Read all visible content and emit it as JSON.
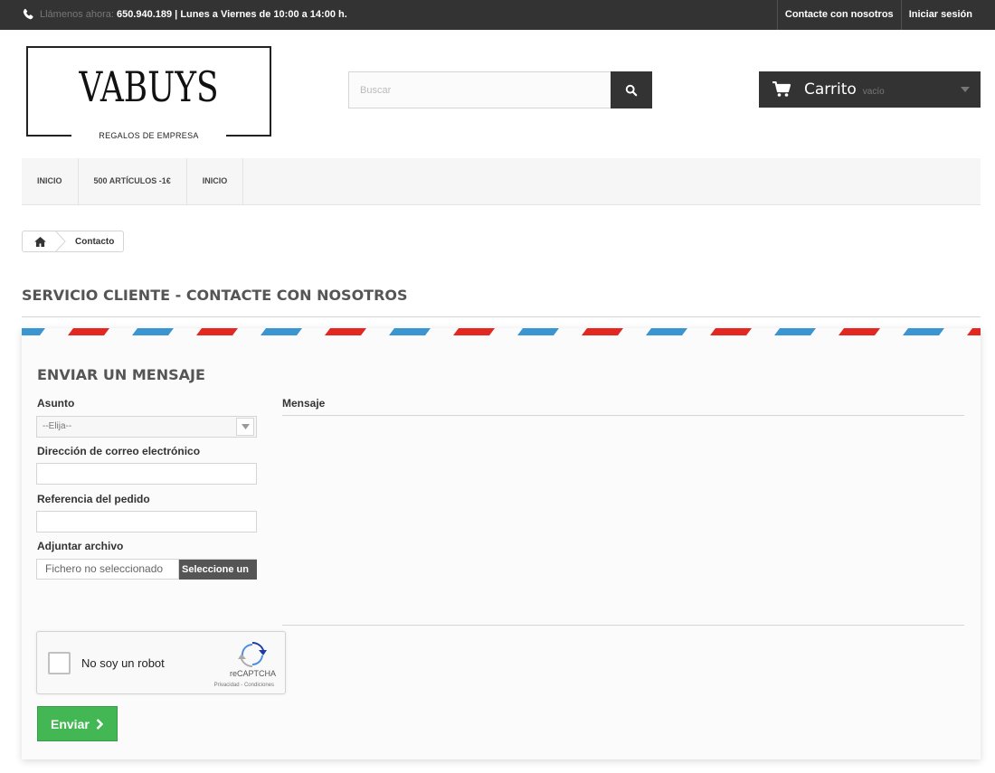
{
  "topbar": {
    "phone_prefix": "Llámenos ahora:",
    "phone_info": "650.940.189 | Lunes a Viernes de 10:00 a 14:00 h.",
    "links": [
      "Contacte con nosotros",
      "Iniciar sesión"
    ]
  },
  "logo": {
    "name": "VABUYS",
    "tagline": "REGALOS DE EMPRESA"
  },
  "search": {
    "placeholder": "Buscar",
    "icon": "search-icon"
  },
  "cart": {
    "title": "Carrito",
    "status": "vacío",
    "icon": "shopping-cart-icon"
  },
  "menu": {
    "items": [
      "INICIO",
      "500 ARTÍCULOS -1€",
      "INICIO"
    ]
  },
  "breadcrumb": {
    "current": "Contacto"
  },
  "page": {
    "heading": "SERVICIO CLIENTE - CONTACTE CON NOSOTROS"
  },
  "form": {
    "title": "ENVIAR UN MENSAJE",
    "subject_label": "Asunto",
    "subject_value": "--Elija--",
    "email_label": "Dirección de correo electrónico",
    "order_label": "Referencia del pedido",
    "attach_label": "Adjuntar archivo",
    "file_status": "Fichero no seleccionado",
    "file_button": "Seleccione un",
    "message_label": "Mensaje",
    "submit_label": "Enviar"
  },
  "captcha": {
    "label": "No soy un robot",
    "brand": "reCAPTCHA",
    "terms": "Privacidad - Condiciones"
  },
  "colors": {
    "topbar_bg": "#333333",
    "submit_green": "#43b754",
    "stripe_red": "#e32822",
    "stripe_blue": "#3b95d1"
  }
}
